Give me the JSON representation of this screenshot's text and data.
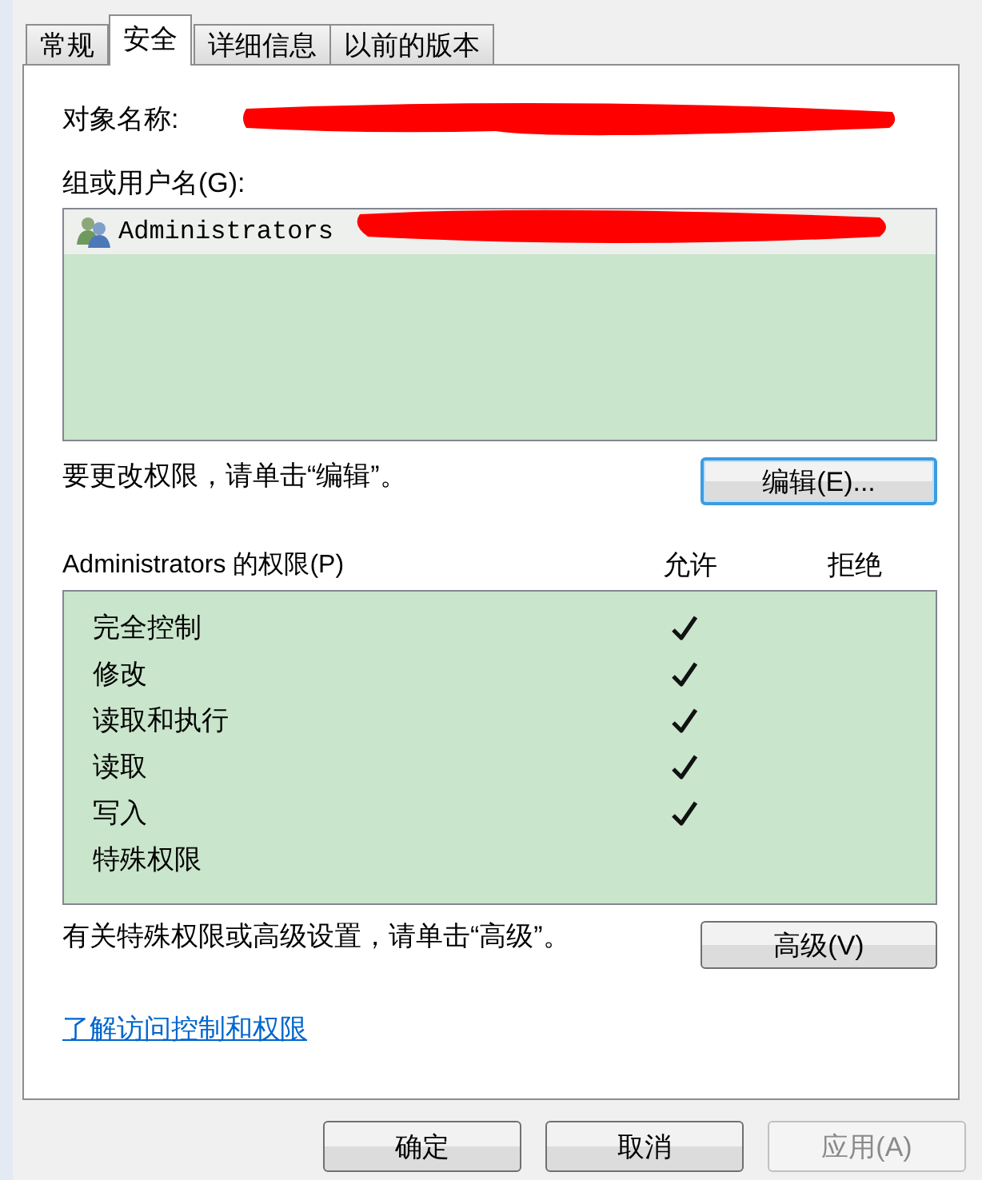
{
  "tabs": [
    {
      "label": "常规",
      "selected": false
    },
    {
      "label": "安全",
      "selected": true
    },
    {
      "label": "详细信息",
      "selected": false
    },
    {
      "label": "以前的版本",
      "selected": false
    }
  ],
  "object_name": {
    "label": "对象名称:"
  },
  "groups": {
    "label": "组或用户名(G):",
    "items": [
      {
        "name": "Administrators",
        "selected": true
      }
    ]
  },
  "edit_hint": "要更改权限，请单击“编辑”。",
  "edit_button": "编辑(E)...",
  "permissions": {
    "label": "Administrators 的权限(P)",
    "allow_label": "允许",
    "deny_label": "拒绝",
    "rows": [
      {
        "name": "完全控制",
        "allow": true,
        "deny": false
      },
      {
        "name": "修改",
        "allow": true,
        "deny": false
      },
      {
        "name": "读取和执行",
        "allow": true,
        "deny": false
      },
      {
        "name": "读取",
        "allow": true,
        "deny": false
      },
      {
        "name": "写入",
        "allow": true,
        "deny": false
      },
      {
        "name": "特殊权限",
        "allow": false,
        "deny": false
      }
    ]
  },
  "advanced_hint": "有关特殊权限或高级设置，请单击“高级”。",
  "advanced_button": "高级(V)",
  "help_link": "了解访问控制和权限",
  "buttons": [
    {
      "label": "确定",
      "disabled": false
    },
    {
      "label": "取消",
      "disabled": false
    },
    {
      "label": "应用(A)",
      "disabled": true
    }
  ]
}
